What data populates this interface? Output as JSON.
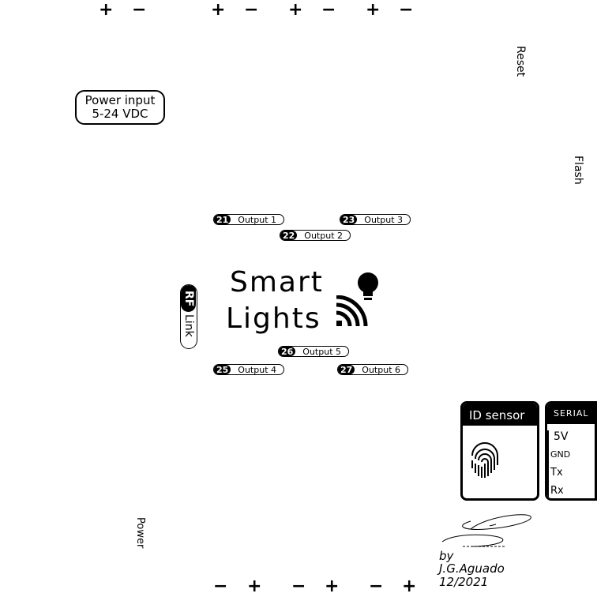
{
  "top_terminals": [
    {
      "plus": "+",
      "minus": "−"
    },
    {
      "plus": "+",
      "minus": "−"
    },
    {
      "plus": "+",
      "minus": "−"
    },
    {
      "plus": "+",
      "minus": "−"
    }
  ],
  "bottom_terminals": [
    {
      "minus": "−",
      "plus": "+"
    },
    {
      "minus": "−",
      "plus": "+"
    },
    {
      "minus": "−",
      "plus": "+"
    }
  ],
  "power_input": {
    "line1": "Power input",
    "line2": "5-24 VDC"
  },
  "reset_label": "Reset",
  "flash_label": "Flash",
  "power_label": "Power",
  "outputs": [
    {
      "pin": "21",
      "label": "Output 1"
    },
    {
      "pin": "22",
      "label": "Output 2"
    },
    {
      "pin": "23",
      "label": "Output 3"
    },
    {
      "pin": "25",
      "label": "Output 4"
    },
    {
      "pin": "26",
      "label": "Output 5"
    },
    {
      "pin": "27",
      "label": "Output 6"
    }
  ],
  "rf_link": {
    "top": "RF",
    "bottom": "Link"
  },
  "logo": {
    "line1": "Smart",
    "line2": "Lights"
  },
  "id_sensor": {
    "title": "ID sensor"
  },
  "serial": {
    "title": "SERIAL",
    "pins": [
      "5V",
      "GND",
      "Tx",
      "Rx"
    ]
  },
  "credit": {
    "line1": "by",
    "line2": "J.G.Aguado",
    "line3": "12/2021"
  },
  "icons": [
    "bulb-icon",
    "wifi-icon",
    "fingerprint-icon",
    "signature-icon"
  ]
}
